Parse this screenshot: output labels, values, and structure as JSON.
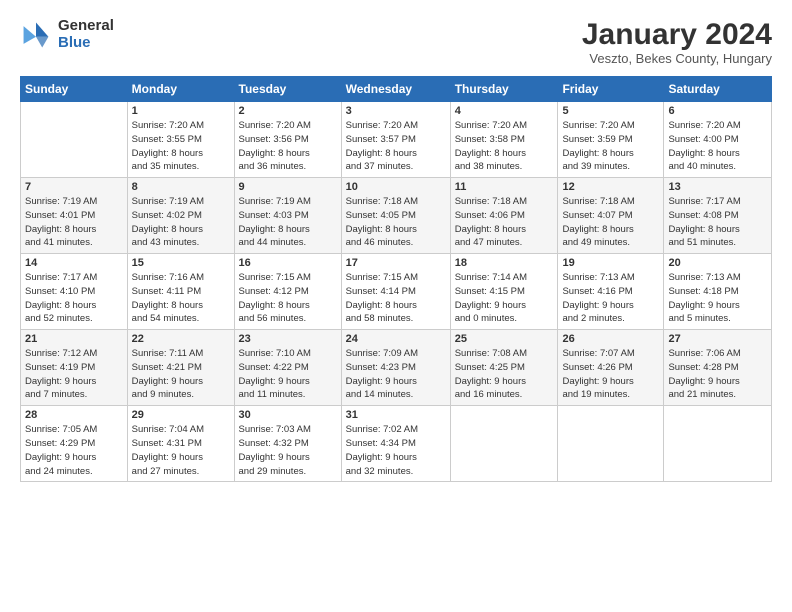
{
  "logo": {
    "general": "General",
    "blue": "Blue"
  },
  "header": {
    "month_title": "January 2024",
    "location": "Veszto, Bekes County, Hungary"
  },
  "weekdays": [
    "Sunday",
    "Monday",
    "Tuesday",
    "Wednesday",
    "Thursday",
    "Friday",
    "Saturday"
  ],
  "weeks": [
    [
      {
        "day": "",
        "info": ""
      },
      {
        "day": "1",
        "info": "Sunrise: 7:20 AM\nSunset: 3:55 PM\nDaylight: 8 hours\nand 35 minutes."
      },
      {
        "day": "2",
        "info": "Sunrise: 7:20 AM\nSunset: 3:56 PM\nDaylight: 8 hours\nand 36 minutes."
      },
      {
        "day": "3",
        "info": "Sunrise: 7:20 AM\nSunset: 3:57 PM\nDaylight: 8 hours\nand 37 minutes."
      },
      {
        "day": "4",
        "info": "Sunrise: 7:20 AM\nSunset: 3:58 PM\nDaylight: 8 hours\nand 38 minutes."
      },
      {
        "day": "5",
        "info": "Sunrise: 7:20 AM\nSunset: 3:59 PM\nDaylight: 8 hours\nand 39 minutes."
      },
      {
        "day": "6",
        "info": "Sunrise: 7:20 AM\nSunset: 4:00 PM\nDaylight: 8 hours\nand 40 minutes."
      }
    ],
    [
      {
        "day": "7",
        "info": "Sunrise: 7:19 AM\nSunset: 4:01 PM\nDaylight: 8 hours\nand 41 minutes."
      },
      {
        "day": "8",
        "info": "Sunrise: 7:19 AM\nSunset: 4:02 PM\nDaylight: 8 hours\nand 43 minutes."
      },
      {
        "day": "9",
        "info": "Sunrise: 7:19 AM\nSunset: 4:03 PM\nDaylight: 8 hours\nand 44 minutes."
      },
      {
        "day": "10",
        "info": "Sunrise: 7:18 AM\nSunset: 4:05 PM\nDaylight: 8 hours\nand 46 minutes."
      },
      {
        "day": "11",
        "info": "Sunrise: 7:18 AM\nSunset: 4:06 PM\nDaylight: 8 hours\nand 47 minutes."
      },
      {
        "day": "12",
        "info": "Sunrise: 7:18 AM\nSunset: 4:07 PM\nDaylight: 8 hours\nand 49 minutes."
      },
      {
        "day": "13",
        "info": "Sunrise: 7:17 AM\nSunset: 4:08 PM\nDaylight: 8 hours\nand 51 minutes."
      }
    ],
    [
      {
        "day": "14",
        "info": "Sunrise: 7:17 AM\nSunset: 4:10 PM\nDaylight: 8 hours\nand 52 minutes."
      },
      {
        "day": "15",
        "info": "Sunrise: 7:16 AM\nSunset: 4:11 PM\nDaylight: 8 hours\nand 54 minutes."
      },
      {
        "day": "16",
        "info": "Sunrise: 7:15 AM\nSunset: 4:12 PM\nDaylight: 8 hours\nand 56 minutes."
      },
      {
        "day": "17",
        "info": "Sunrise: 7:15 AM\nSunset: 4:14 PM\nDaylight: 8 hours\nand 58 minutes."
      },
      {
        "day": "18",
        "info": "Sunrise: 7:14 AM\nSunset: 4:15 PM\nDaylight: 9 hours\nand 0 minutes."
      },
      {
        "day": "19",
        "info": "Sunrise: 7:13 AM\nSunset: 4:16 PM\nDaylight: 9 hours\nand 2 minutes."
      },
      {
        "day": "20",
        "info": "Sunrise: 7:13 AM\nSunset: 4:18 PM\nDaylight: 9 hours\nand 5 minutes."
      }
    ],
    [
      {
        "day": "21",
        "info": "Sunrise: 7:12 AM\nSunset: 4:19 PM\nDaylight: 9 hours\nand 7 minutes."
      },
      {
        "day": "22",
        "info": "Sunrise: 7:11 AM\nSunset: 4:21 PM\nDaylight: 9 hours\nand 9 minutes."
      },
      {
        "day": "23",
        "info": "Sunrise: 7:10 AM\nSunset: 4:22 PM\nDaylight: 9 hours\nand 11 minutes."
      },
      {
        "day": "24",
        "info": "Sunrise: 7:09 AM\nSunset: 4:23 PM\nDaylight: 9 hours\nand 14 minutes."
      },
      {
        "day": "25",
        "info": "Sunrise: 7:08 AM\nSunset: 4:25 PM\nDaylight: 9 hours\nand 16 minutes."
      },
      {
        "day": "26",
        "info": "Sunrise: 7:07 AM\nSunset: 4:26 PM\nDaylight: 9 hours\nand 19 minutes."
      },
      {
        "day": "27",
        "info": "Sunrise: 7:06 AM\nSunset: 4:28 PM\nDaylight: 9 hours\nand 21 minutes."
      }
    ],
    [
      {
        "day": "28",
        "info": "Sunrise: 7:05 AM\nSunset: 4:29 PM\nDaylight: 9 hours\nand 24 minutes."
      },
      {
        "day": "29",
        "info": "Sunrise: 7:04 AM\nSunset: 4:31 PM\nDaylight: 9 hours\nand 27 minutes."
      },
      {
        "day": "30",
        "info": "Sunrise: 7:03 AM\nSunset: 4:32 PM\nDaylight: 9 hours\nand 29 minutes."
      },
      {
        "day": "31",
        "info": "Sunrise: 7:02 AM\nSunset: 4:34 PM\nDaylight: 9 hours\nand 32 minutes."
      },
      {
        "day": "",
        "info": ""
      },
      {
        "day": "",
        "info": ""
      },
      {
        "day": "",
        "info": ""
      }
    ]
  ]
}
